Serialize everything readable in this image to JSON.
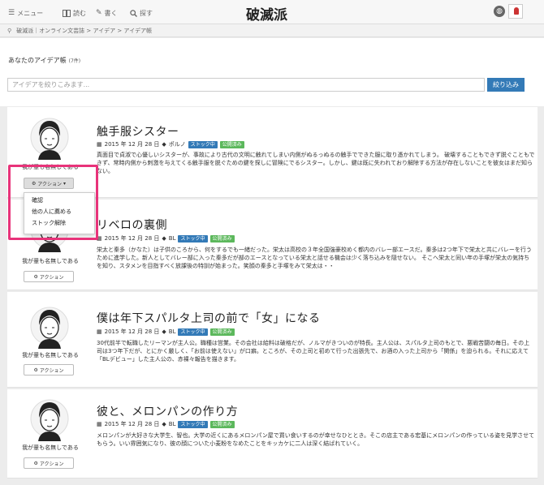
{
  "nav": {
    "menu": "メニュー",
    "read": "読む",
    "write": "書く",
    "explore": "探す",
    "logo": "破滅派",
    "icons": {
      "menu": "bars-icon",
      "read": "book-icon",
      "write": "pen-icon",
      "explore": "search-icon",
      "language": "globe-icon"
    }
  },
  "breadcrumb": "破滅派｜オンライン文芸誌 > アイデア > アイデア帳",
  "panel": {
    "title": "あなたのアイデア帳",
    "count": "(7件)",
    "search_placeholder": "アイデアを絞りこみます...",
    "search_button": "絞り込み"
  },
  "colors": {
    "stock": "#337ab7",
    "published": "#5cb85c",
    "accent": "#e8337a"
  },
  "cards": [
    {
      "author": "我が輩も名無しである",
      "action": "アクション",
      "title": "触手服シスター",
      "date": "2015 年 12 月 28 日",
      "tag": "ポルノ",
      "badge_stock": "ストック中",
      "badge_public": "公開済み",
      "body": "真面目で貞淑で心優しいシスターが、事故により古代の文明に触れてしまい内側がぬるっぬるの触手でできた服に取り憑かれてしまう。 破壊することもできず脱ぐこともできず、常時内側から刺激を与えてくる触手服を脱ぐための鍵を探しに冒険にでるシスター。しかし、鍵は既に失われており解除する方法が存在しないことを彼女はまだ知らない。"
    },
    {
      "author": "我が輩も名無しである",
      "action": "アクション",
      "title": "リベロの裏側",
      "date": "2015 年 12 月 28 日",
      "tag": "BL",
      "badge_stock": "ストック中",
      "badge_public": "公開済み",
      "body": "栄太と秦多（かなた）は子供のころから、何をするでも一緒だった。栄太は高校の３年全国強豪校めく都内のバレー部エースだ。秦多は2つ年下で栄太と共にバレーを行うために進学した。新人としてバレー部に入った秦多だが部のエースとなっている栄太と話せる機会は少く落ち込みを隠せない。 そこへ栄太と同い年の手塚が栄太の気持ちを知り、スタメンを目指すべく放課後の特訓が始まった。笑顔の秦多と手塚をみて栄太は・・"
    },
    {
      "author": "我が輩も名無しである",
      "action": "アクション",
      "title": "僕は年下スパルタ上司の前で「女」になる",
      "date": "2015 年 12 月 28 日",
      "tag": "BL",
      "badge_stock": "ストック中",
      "badge_public": "公開済み",
      "body": "30代前半で転職したリーマンが主人公。職種は営業。その会社は給料は破格だが、ノルマがきついのが特長。主人公は、スパルタ上司のもとで、悪戦苦闘の毎日。その上司は3つ年下だが、とにかく厳しく、「お前は使えない」が口癖。ところが、その上司と初めて行った出張先で、お酒の入った上司から「関係」を迫られる。それに応えて「BLデビュー」した主人公の、赤裸々報告を描きます。"
    },
    {
      "author": "我が輩も名無しである",
      "action": "アクション",
      "title": "彼と、メロンパンの作り方",
      "date": "2015 年 12 月 28 日",
      "tag": "BL",
      "badge_stock": "ストック中",
      "badge_public": "公開済み",
      "body": "メロンパンが大好きな大学生、智也。大学の近くにあるメロンパン屋で買い食いするのが幸せなひととき。そこの店主である宏基にメロンパンの作っている姿を見学させてもらう。いい雰囲気になり、彼の顔についた小麦粉をなめたことをキッカケに二人は深く結ばれていく。"
    }
  ],
  "dropdown": {
    "items": [
      "確認",
      "他の人に薦める",
      "ストック解除"
    ]
  }
}
